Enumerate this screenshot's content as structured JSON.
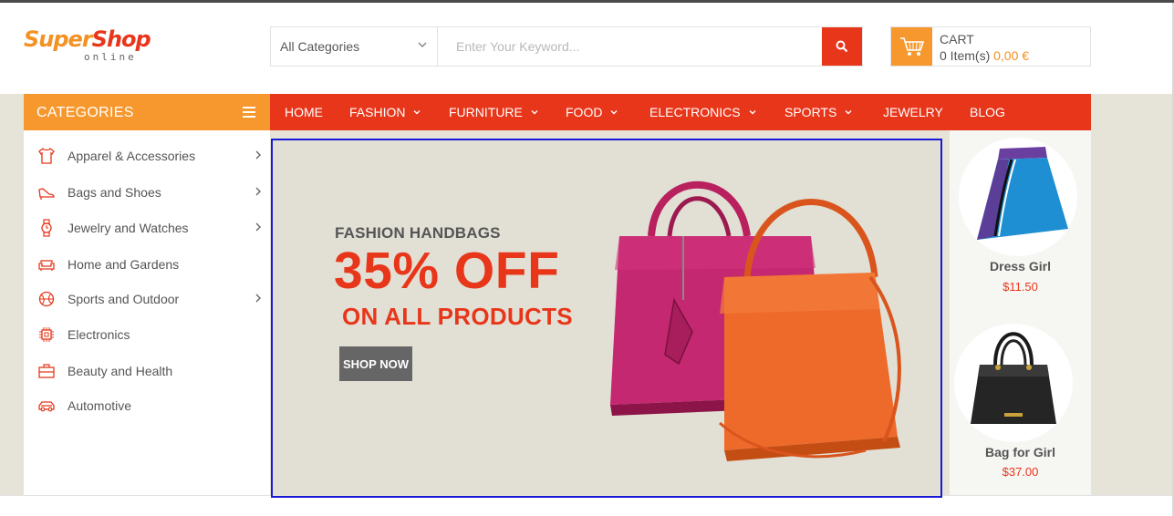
{
  "brand": {
    "name_part1": "Super",
    "name_part2": "Shop",
    "tagline": "online"
  },
  "search": {
    "category_selected": "All Categories",
    "keyword_placeholder": "Enter Your Keyword...",
    "keyword_value": ""
  },
  "cart": {
    "title": "CART",
    "items_text": "0 Item(s)",
    "amount": "0,00 €"
  },
  "categories": {
    "header": "CATEGORIES",
    "items": [
      {
        "label": "Apparel & Accessories",
        "icon": "shirt-icon",
        "has_sub": true
      },
      {
        "label": "Bags and Shoes",
        "icon": "shoe-icon",
        "has_sub": true
      },
      {
        "label": "Jewelry and Watches",
        "icon": "watch-icon",
        "has_sub": true
      },
      {
        "label": "Home and Gardens",
        "icon": "sofa-icon",
        "has_sub": false
      },
      {
        "label": "Sports and Outdoor",
        "icon": "ball-icon",
        "has_sub": true
      },
      {
        "label": "Electronics",
        "icon": "chip-icon",
        "has_sub": false
      },
      {
        "label": "Beauty and Health",
        "icon": "briefcase-icon",
        "has_sub": false
      },
      {
        "label": "Automotive",
        "icon": "car-icon",
        "has_sub": false
      }
    ]
  },
  "nav": [
    {
      "label": "HOME",
      "dropdown": false
    },
    {
      "label": "FASHION",
      "dropdown": true
    },
    {
      "label": "FURNITURE",
      "dropdown": true
    },
    {
      "label": "FOOD",
      "dropdown": true
    },
    {
      "label": "ELECTRONICS",
      "dropdown": true
    },
    {
      "label": "SPORTS",
      "dropdown": true
    },
    {
      "label": "JEWELRY",
      "dropdown": false
    },
    {
      "label": "BLOG",
      "dropdown": false
    }
  ],
  "banner": {
    "kicker": "FASHION HANDBAGS",
    "headline": "35% OFF",
    "subheadline": "ON ALL PRODUCTS",
    "cta": "SHOP NOW"
  },
  "products": [
    {
      "name": "Dress Girl",
      "price": "$11.50"
    },
    {
      "name": "Bag for Girl",
      "price": "$37.00"
    }
  ],
  "colors": {
    "primary": "#e8361b",
    "accent": "#f7982e",
    "band": "#e6e4d9"
  }
}
